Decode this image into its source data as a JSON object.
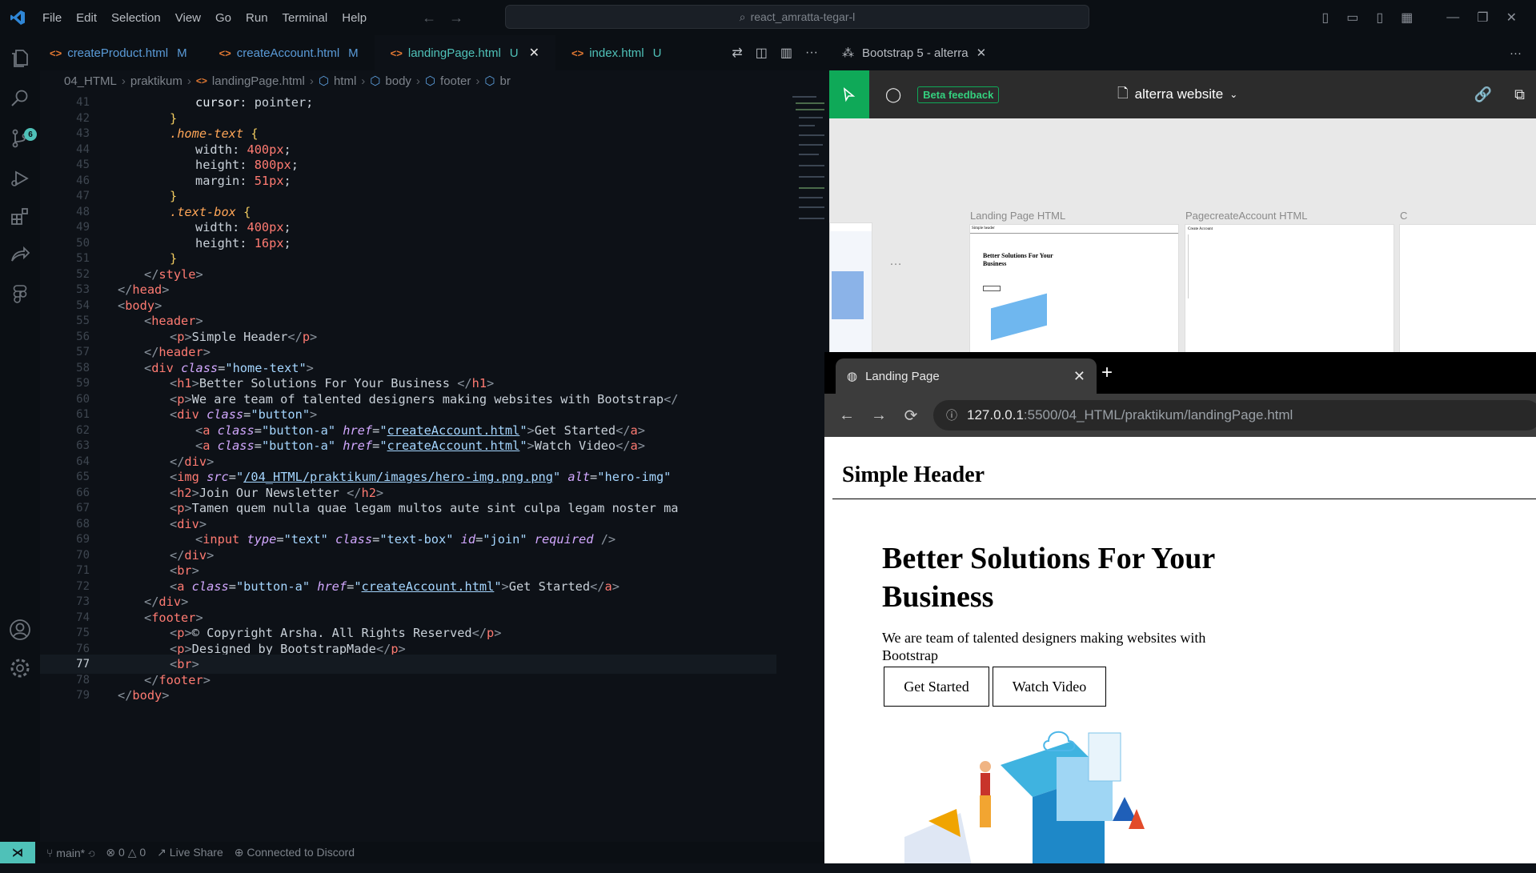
{
  "titlebar": {
    "menu": [
      "File",
      "Edit",
      "Selection",
      "View",
      "Go",
      "Run",
      "Terminal",
      "Help"
    ],
    "search": "react_amratta-tegar-l"
  },
  "activity": {
    "scm_badge": "6"
  },
  "tabs": [
    {
      "label": "createProduct.html",
      "status": "M"
    },
    {
      "label": "createAccount.html",
      "status": "M"
    },
    {
      "label": "landingPage.html",
      "status": "U"
    },
    {
      "label": "index.html",
      "status": "U"
    }
  ],
  "breadcrumb": [
    "04_HTML",
    "praktikum",
    "landingPage.html",
    "html",
    "body",
    "footer",
    "br"
  ],
  "code": {
    "line_numbers": [
      "41",
      "42",
      "43",
      "44",
      "45",
      "46",
      "47",
      "48",
      "49",
      "50",
      "51",
      "52",
      "53",
      "54",
      "55",
      "56",
      "57",
      "58",
      "59",
      "60",
      "61",
      "62",
      "63",
      "64",
      "65",
      "66",
      "67",
      "68",
      "69",
      "70",
      "71",
      "72",
      "73",
      "74",
      "75",
      "76",
      "77",
      "78",
      "79"
    ],
    "lines": {
      "l41a": "cursor",
      "l41b": ": ",
      "l41c": "pointer",
      "l41d": ";",
      "l43a": ".home-text",
      "l43b": " {",
      "l44a": "width",
      "l44b": ": ",
      "l44c": "400px",
      "l44d": ";",
      "l45a": "height",
      "l45b": ": ",
      "l45c": "800px",
      "l45d": ";",
      "l46a": "margin",
      "l46b": ": ",
      "l46c": "51px",
      "l46d": ";",
      "l48a": ".text-box",
      "l48b": " {",
      "l49a": "width",
      "l49b": ": ",
      "l49c": "400px",
      "l49d": ";",
      "l50a": "height",
      "l50b": ": ",
      "l50c": "16px",
      "l50d": ";",
      "l56": "Simple Header",
      "l59": "Better Solutions For Your Business ",
      "l60": "We are team of talented designers making websites with Bootstrap",
      "l62text": "Get Started",
      "l63text": "Watch Video",
      "href": "createAccount.html",
      "imgsrc": "/04_HTML/praktikum/images/hero-img.png.png",
      "alt": "hero-img",
      "l66": "Join Our Newsletter ",
      "l67": "Tamen quem nulla quae legam multos aute sint culpa legam noster ma",
      "l72text": "Get Started",
      "l75": "© Copyright Arsha. All Rights Reserved",
      "l76": "Designed by BootstrapMade"
    }
  },
  "status": {
    "branch": "main*",
    "problems": "0",
    "warnings": "0",
    "live_share": "Live Share",
    "discord": "Connected to Discord"
  },
  "figma": {
    "tab_title": "Bootstrap 5 - alterra",
    "beta": "Beta feedback",
    "file_name": "alterra website",
    "frame1_label": "Landing Page HTML",
    "frame2_label": "PagecreateAccount HTML",
    "frame3_label": "C",
    "frame1_header": "Simple header",
    "frame1_title": "Better Solutions For Your Business",
    "frame2_title": "Create Account"
  },
  "browser": {
    "tab_title": "Landing Page",
    "url_host": "127.0.0.1",
    "url_path": ":5500/04_HTML/praktikum/landingPage.html",
    "header": "Simple Header",
    "h1": "Better Solutions For Your Business",
    "p": "We are team of talented designers making websites with Bootstrap",
    "btn1": "Get Started",
    "btn2": "Watch Video"
  }
}
